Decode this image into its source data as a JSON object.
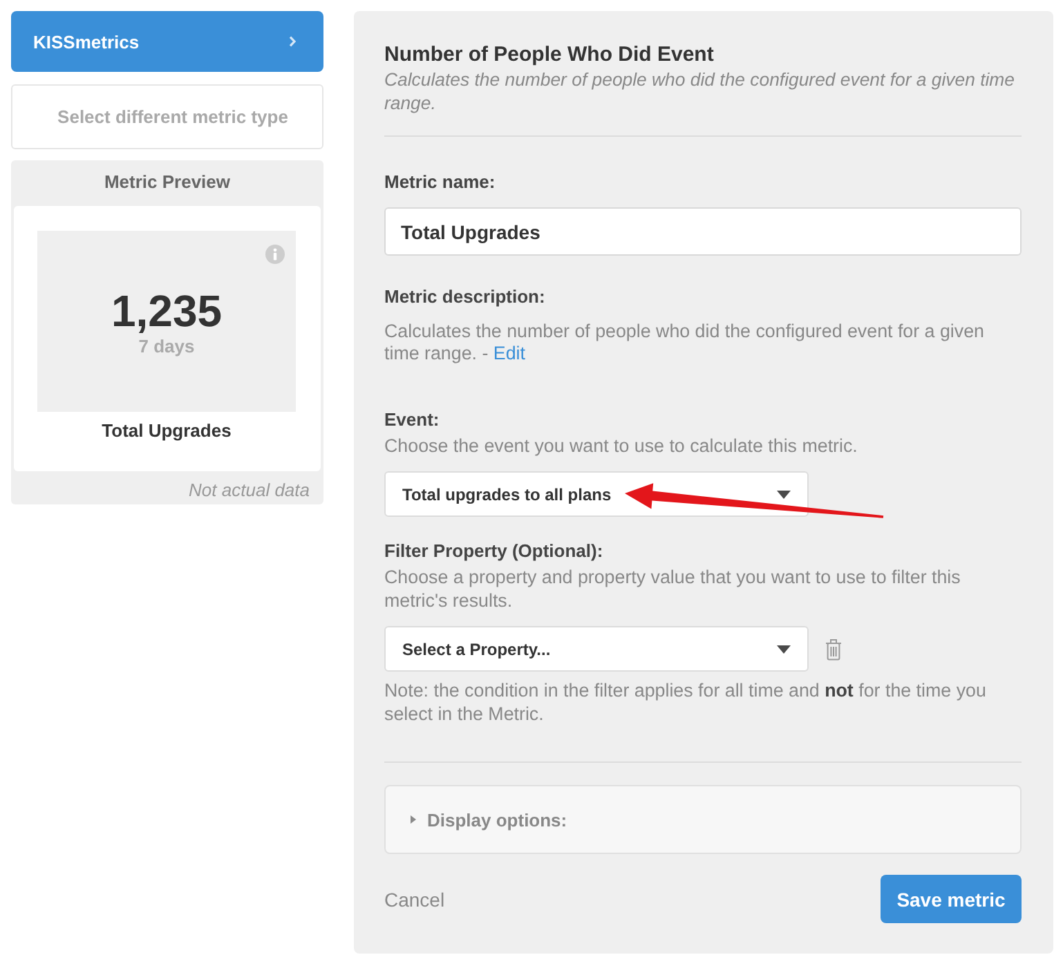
{
  "sidebar": {
    "brand": {
      "label": "KISSmetrics"
    },
    "change_type_button": {
      "label": "Select different metric type"
    },
    "preview": {
      "title": "Metric Preview",
      "value": "1,235",
      "period": "7 days",
      "metric_name": "Total Upgrades",
      "note": "Not actual data"
    }
  },
  "form": {
    "title": "Number of People Who Did Event",
    "subtitle": "Calculates the number of people who did the configured event for a given time range.",
    "fields": [
      {
        "kind": "text",
        "label": "Metric name:",
        "value": "Total Upgrades"
      },
      {
        "kind": "description",
        "label": "Metric description:",
        "text": "Calculates the number of people who did the configured event for a given time range. -",
        "link": "Edit"
      },
      {
        "kind": "select",
        "label": "Event:",
        "help": "Choose the event you want to use to calculate this metric.",
        "value": "Total upgrades to all plans",
        "removable": false
      },
      {
        "kind": "select",
        "label": "Filter Property (Optional):",
        "help": "Choose a property and property value that you want to use to filter this metric's results.",
        "value": "Select a Property...",
        "removable": true,
        "note": "Note: the condition in the filter applies for all time and **not** for the time you select in the Metric."
      }
    ],
    "display_options": {
      "label": "Display options:",
      "expanded": false
    },
    "actions": {
      "cancel": "Cancel",
      "save": "Save metric"
    }
  }
}
